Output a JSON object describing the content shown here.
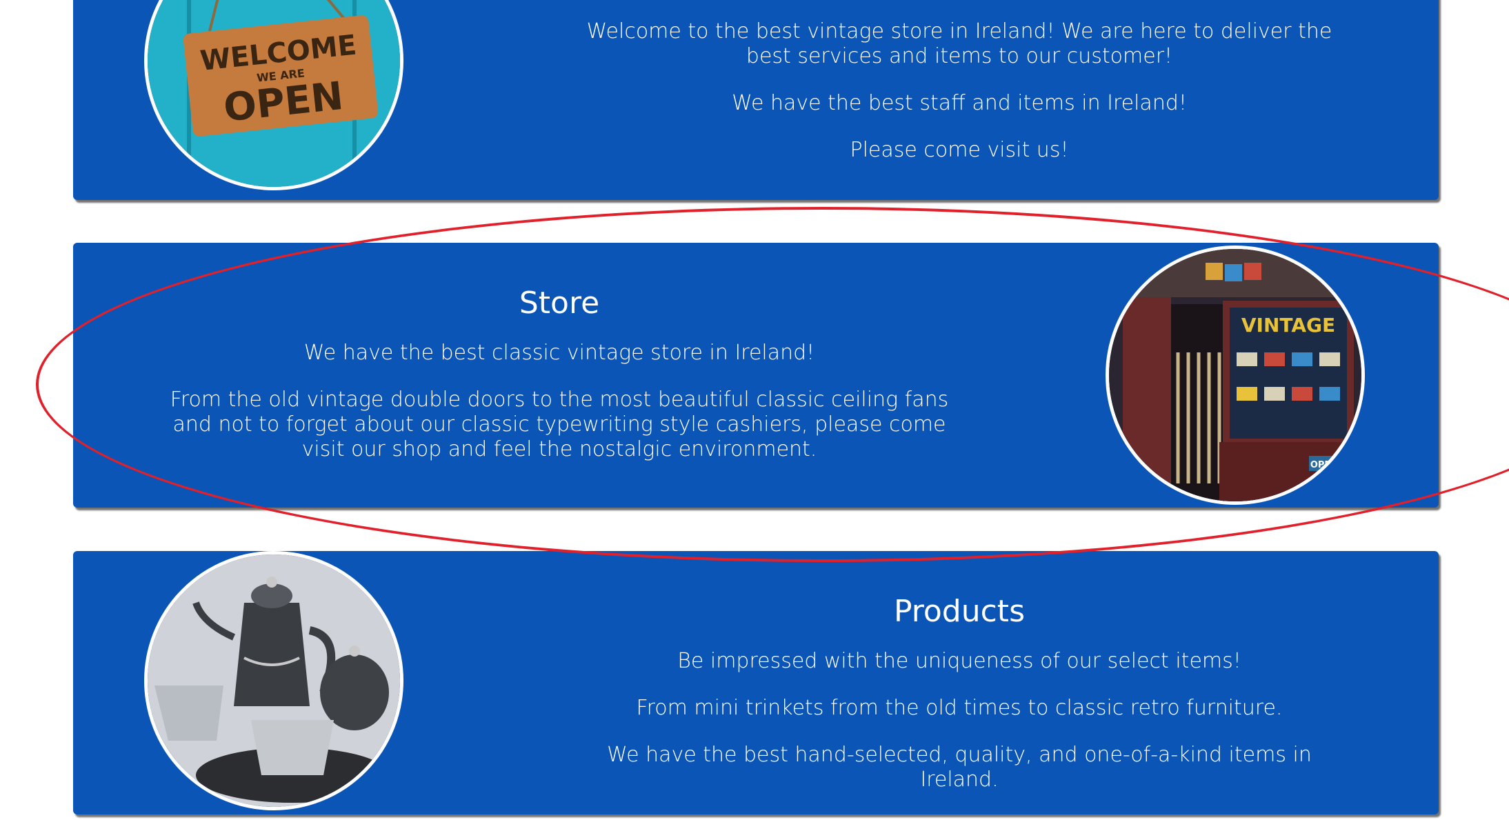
{
  "sections": {
    "about": {
      "paragraphs": [
        "Welcome to the best vintage store in Ireland! We are here to deliver the best services and items to our customer!",
        "We have the best staff and items in Ireland!",
        "Please come visit us!"
      ],
      "image_sign_lines": [
        "WELCOME",
        "WE ARE",
        "OPEN"
      ]
    },
    "store": {
      "title": "Store",
      "paragraphs": [
        "We have the best classic vintage store in Ireland!",
        "From the old vintage double doors to the most beautiful classic ceiling fans and not to forget about our classic typewriting style cashiers, please come visit our shop and feel the nostalgic environment."
      ],
      "image_sign": "VINTAGE",
      "image_open_tag": "OPEN"
    },
    "products": {
      "title": "Products",
      "paragraphs": [
        "Be impressed with the uniqueness of our select items!",
        "From mini trinkets from the old times to classic retro furniture.",
        "We have the best hand-selected, quality, and one-of-a-kind items in Ireland."
      ]
    }
  },
  "colors": {
    "card_background": "#0b55b7",
    "card_text": "#ffffff",
    "annotation": "#e0202a"
  }
}
